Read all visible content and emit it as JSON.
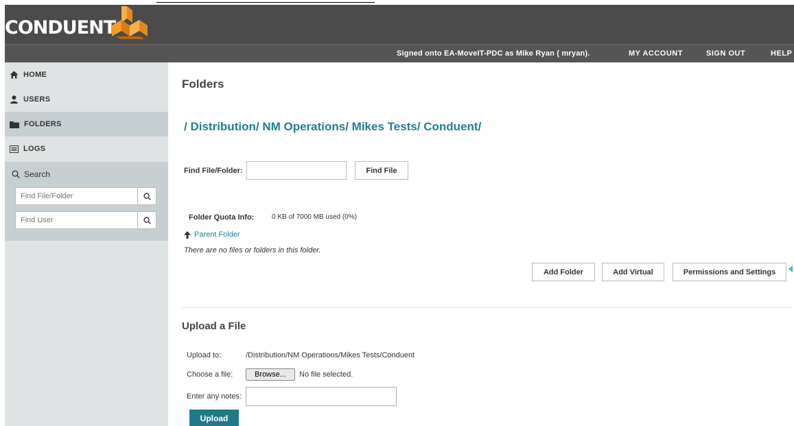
{
  "header": {
    "logo_text": "CONDUENT",
    "signed_in_text": "Signed onto EA-MoveIT-PDC as Mike Ryan ( mryan).",
    "nav": [
      {
        "label": "MY ACCOUNT"
      },
      {
        "label": "SIGN OUT"
      },
      {
        "label": "HELP"
      }
    ]
  },
  "sidebar": {
    "items": [
      {
        "label": "HOME",
        "icon": "home-icon"
      },
      {
        "label": "USERS",
        "icon": "user-icon"
      },
      {
        "label": "FOLDERS",
        "icon": "folder-icon"
      },
      {
        "label": "LOGS",
        "icon": "log-icon"
      }
    ],
    "search_label": "Search",
    "find_file_placeholder": "Find File/Folder",
    "find_user_placeholder": "Find User"
  },
  "main": {
    "title": "Folders",
    "breadcrumb": [
      "/",
      "Distribution/",
      "NM Operations/",
      "Mikes Tests/",
      "Conduent/"
    ],
    "find_label": "Find File/Folder:",
    "find_input_value": "",
    "find_button": "Find File",
    "quota_label": "Folder Quota Info:",
    "quota_value": "0 KB of 7000 MB used (0%)",
    "parent_folder": "Parent Folder",
    "empty_message": "There are no files or folders in this folder.",
    "actions": {
      "add_folder": "Add Folder",
      "add_virtual": "Add Virtual",
      "permissions": "Permissions and Settings"
    }
  },
  "upload": {
    "title": "Upload a File",
    "upload_to_label": "Upload to:",
    "upload_to_value": "/Distribution/NM Operations/Mikes Tests/Conduent",
    "choose_label": "Choose a file:",
    "browse_button": "Browse...",
    "no_file_text": "No file selected.",
    "notes_label": "Enter any notes:",
    "notes_value": "",
    "upload_button": "Upload"
  },
  "colors": {
    "accent": "#1f7f8f",
    "header_bg": "#4b4b4b",
    "sidebar_bg": "#dfe3e4",
    "sidebar_active": "#c6d0d3",
    "logo_orange": "#f39c2b"
  }
}
